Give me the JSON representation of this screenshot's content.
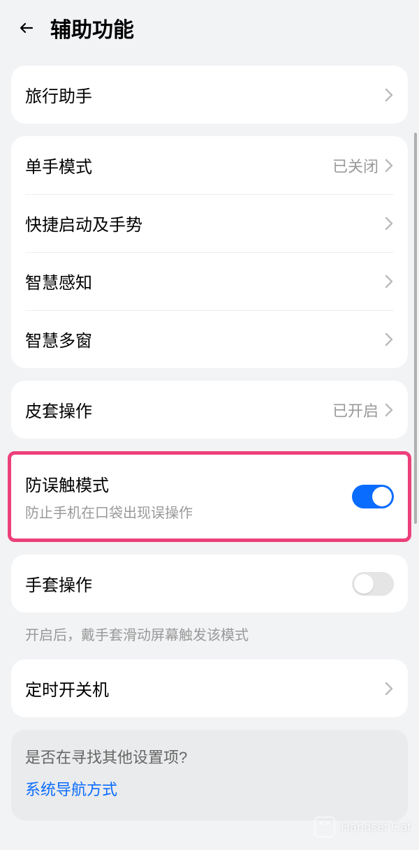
{
  "header": {
    "title": "辅助功能"
  },
  "group1": {
    "travel_assistant": "旅行助手"
  },
  "group2": {
    "one_handed": {
      "label": "单手模式",
      "value": "已关闭"
    },
    "shortcuts": {
      "label": "快捷启动及手势"
    },
    "smart_sensing": {
      "label": "智慧感知"
    },
    "smart_multiwindow": {
      "label": "智慧多窗"
    }
  },
  "group3": {
    "leather_case": {
      "label": "皮套操作",
      "value": "已开启"
    }
  },
  "group4": {
    "pocket_mode": {
      "label": "防误触模式",
      "subtitle": "防止手机在口袋出现误操作"
    }
  },
  "group5": {
    "glove_mode": {
      "label": "手套操作"
    },
    "glove_hint": "开启后，戴手套滑动屏幕触发该模式"
  },
  "group6": {
    "scheduled_power": {
      "label": "定时开关机"
    }
  },
  "footer": {
    "question": "是否在寻找其他设置项?",
    "link": "系统导航方式"
  },
  "watermark": "Handset Cat"
}
